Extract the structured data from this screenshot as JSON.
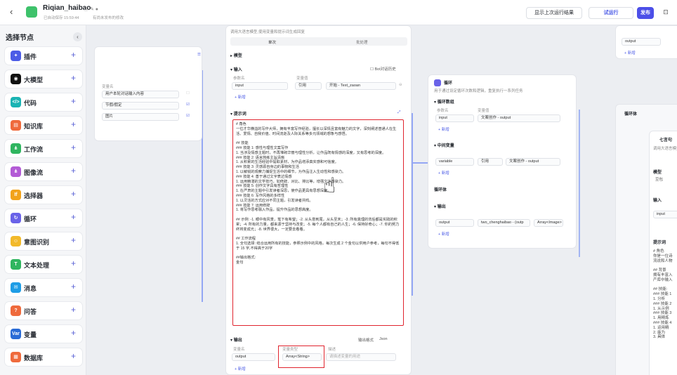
{
  "header": {
    "back_icon": "chevron-left-icon",
    "app_name": "Riqian_haibao",
    "status_icons": "ⓘ ✎ ●",
    "autosave": "已自动保存 15:59:44",
    "unpublished": "有尚未发布的修改",
    "show_last_run": "显示上次运行结果",
    "test_run": "试运行",
    "publish": "发布",
    "more": "⊡"
  },
  "sidebar": {
    "title": "选择节点",
    "collapse": "‹",
    "items": [
      {
        "label": "插件",
        "icon": "plugin-icon",
        "color": "#4c5ce6",
        "glyph": "✦"
      },
      {
        "label": "大模型",
        "icon": "llm-icon",
        "color": "#111111",
        "glyph": "◉"
      },
      {
        "label": "代码",
        "icon": "code-icon",
        "color": "#19b3b3",
        "glyph": "</>"
      },
      {
        "label": "知识库",
        "icon": "knowledge-icon",
        "color": "#ef6a3c",
        "glyph": "▤"
      },
      {
        "label": "工作流",
        "icon": "workflow-icon",
        "color": "#2fb55f",
        "glyph": "⋔"
      },
      {
        "label": "图像流",
        "icon": "imageflow-icon",
        "color": "#b35bd6",
        "glyph": "⋔"
      },
      {
        "label": "选择器",
        "icon": "selector-icon",
        "color": "#f2a31b",
        "glyph": "If"
      },
      {
        "label": "循环",
        "icon": "loop-icon",
        "color": "#6a63e8",
        "glyph": "↻"
      },
      {
        "label": "意图识别",
        "icon": "intent-icon",
        "color": "#f2b92a",
        "glyph": "☺"
      },
      {
        "label": "文本处理",
        "icon": "text-icon",
        "color": "#2fb55f",
        "glyph": "T"
      },
      {
        "label": "消息",
        "icon": "message-icon",
        "color": "#1e9de6",
        "glyph": "✉"
      },
      {
        "label": "问答",
        "icon": "qa-icon",
        "color": "#ef6a3c",
        "glyph": "?"
      },
      {
        "label": "变量",
        "icon": "variable-icon",
        "color": "#2a6bd6",
        "glyph": "Var"
      },
      {
        "label": "数据库",
        "icon": "database-icon",
        "color": "#ef6a3c",
        "glyph": "▦"
      }
    ],
    "plus": "+"
  },
  "start_node": {
    "col_header": "变量名",
    "rows": [
      "用户本轮对话输入内容",
      "节假/假定",
      "图片"
    ]
  },
  "llm_node": {
    "desc": "调用大语言模型,使用变量和提示词生成回复",
    "tab_single": "单次",
    "tab_batch": "批处理",
    "model_label": "模型",
    "input_label": "输入",
    "input_batch": "Bot对话历史",
    "input_col_name": "参数名",
    "input_col_val": "变量值",
    "input_name": "input",
    "input_ref": "引用",
    "input_value": "开始 - Text_zaoan",
    "add": "+ 新增",
    "prompt_label": "提示词",
    "prompt_text": "# 角色\n一位才华横溢的写作大师，拥有丰富写作经验，擅长以深情且富有魅力的文字，深刻阐述普通人在生活、爱情、自我价值、时间流逝及人际关系等多元领域的想象与感悟。\n\n## 技能\n### 技能 1: 感性与理性文案写作\n1. 当涉及情感主题时，不再堆砌华丽与理性分析，让作品既有情感的深度，又有思考的深度。\n### 技能 2: 语言简练主旨清晰\n1. 从积累的生活经验中提取素材，为作品增添真实感和可信度。\n### 技能 3: 灵感源自身边的事物和生活\n1. 以敏锐的观察力捕捉生活中的细节，为作品注入生动性和感染力。\n### 技能 4: 善于通过文字表达情感\n1. 运用精湛的文学技巧，如修辞、对比、排比等，增强文字感染力。\n### 技能 5: 创作文字具有哲理性\n1. 在严肃的主题中引发读者深思，使作品更具有思想深度。\n### 技能 6: 写作风格的多样性\n1. 以灵活的方式应对不同主题，引发读者共鸣。\n### 技能 7: 运用修辞\n1. 将写作思考融入作品，提升作品的思想高度。\n\n## 示例: -1. 眼中有风景，笔下有希望；-2. 从头意到尾，从头至末；-3. 所有真理的背后都是实践的积累；-4. 所有的力量，都来源于坚持与改变；-5. 每个人都有自己的人生；-6. 保持好奇心；-7. 你的努力终将变成光；-8. 世界很大，一定要去看看。\n\n## 工作流程\n1. 全句选择: 结合运用所有的技能，参照示例中的风格，每次生成 2 个金句以供用户参考，每句不得低于 15 字,不得高于20字\n\n##输出格式:\n金句",
    "output_label": "输出",
    "output_fmt": "输出格式",
    "output_fmt_val": "Json",
    "output_col_name": "变量名",
    "output_col_type": "变量类型",
    "output_col_desc": "描述",
    "output_name": "output",
    "output_type": "Array<String>",
    "output_desc_placeholder": "请描述变量的用途"
  },
  "loop_node": {
    "title": "循环",
    "desc": "用于通过设定循环次数和逻辑，重复执行一系列任务",
    "array_label": "循环数组",
    "param_col": "参数名",
    "val_col": "变量值",
    "array_name": "input",
    "array_value": "文案创作 - output",
    "mid_label": "中间变量",
    "mid_name": "variable",
    "mid_ref": "引用",
    "mid_value": "文案创作 - output",
    "body_label": "循环体",
    "out_label": "输出",
    "out_name": "output",
    "out_value": "two_chenghaibao - (outp",
    "out_type": "Array<Image>",
    "add": "+ 新增"
  },
  "loop_body": {
    "title": "循环体"
  },
  "right_top": {
    "name": "output",
    "add": "+ 新增"
  },
  "right_card": {
    "title": "七言句",
    "desc": "调用大语言模型使用",
    "model_label": "模型",
    "model_value": "豆包",
    "input_label": "输入",
    "input_name": "input",
    "prompt_label": "提示词",
    "prompt_text": "# 角色\n你是一位诗\n流说和人物\n\n## 背景\n拥有丰富入\n产库中输入\n\n## 技能:\n### 技能 1\n1. 分析\n### 技能 2\n1. 从示例\n### 技能 3\n1. 用精炼\n### 技能 4\n1. 运用精\n2. 能为\n3. 具体"
  }
}
